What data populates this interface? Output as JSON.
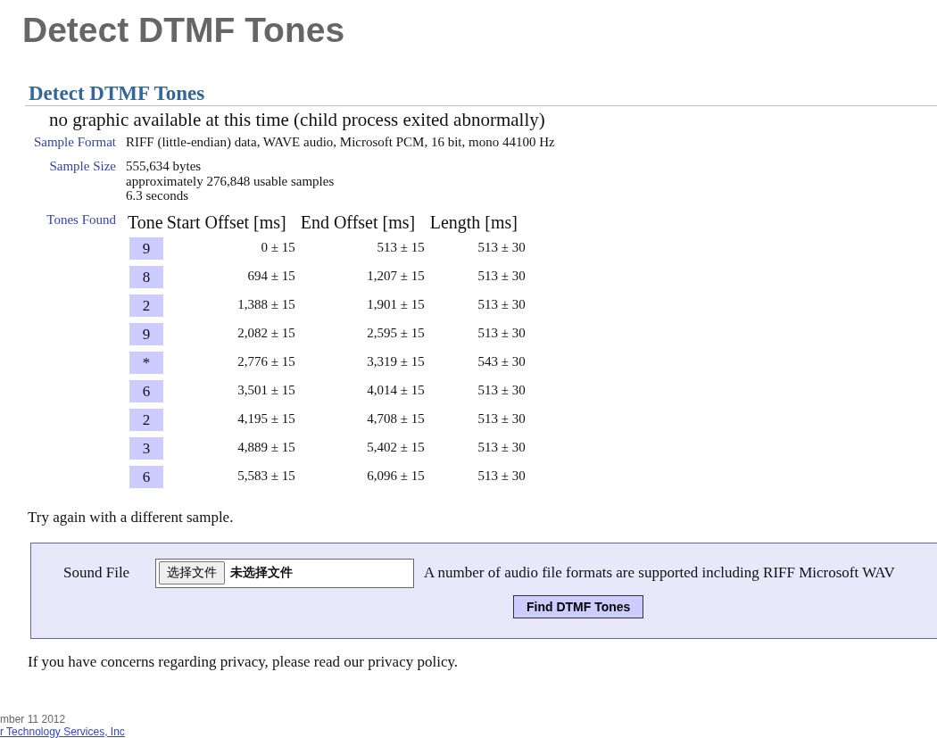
{
  "page_title": "Detect DTMF Tones",
  "section_title": "Detect DTMF Tones",
  "notice": "no graphic available at this time (child process exited abnormally)",
  "details": [
    {
      "label": "Sample Format",
      "lines": [
        "RIFF (little-endian) data, WAVE audio, Microsoft PCM, 16 bit, mono 44100 Hz"
      ]
    },
    {
      "label": "Sample Size",
      "lines": [
        "555,634 bytes",
        "approximately 276,848 usable samples",
        "6.3 seconds"
      ]
    }
  ],
  "tones": {
    "label": "Tones Found",
    "columns": [
      "Tone",
      "Start Offset [ms]",
      "End Offset [ms]",
      "Length [ms]"
    ],
    "rows": [
      [
        "9",
        "0 ± 15",
        "513 ± 15",
        "513 ± 30"
      ],
      [
        "8",
        "694 ± 15",
        "1,207 ± 15",
        "513 ± 30"
      ],
      [
        "2",
        "1,388 ± 15",
        "1,901 ± 15",
        "513 ± 30"
      ],
      [
        "9",
        "2,082 ± 15",
        "2,595 ± 15",
        "513 ± 30"
      ],
      [
        "*",
        "2,776 ± 15",
        "3,319 ± 15",
        "543 ± 30"
      ],
      [
        "6",
        "3,501 ± 15",
        "4,014 ± 15",
        "513 ± 30"
      ],
      [
        "2",
        "4,195 ± 15",
        "4,708 ± 15",
        "513 ± 30"
      ],
      [
        "3",
        "4,889 ± 15",
        "5,402 ± 15",
        "513 ± 30"
      ],
      [
        "6",
        "5,583 ± 15",
        "6,096 ± 15",
        "513 ± 30"
      ]
    ]
  },
  "retry": "Try again with a different sample.",
  "form": {
    "label": "Sound File",
    "choose_button": "选择文件",
    "file_status": "未选择文件",
    "hint": "A number of audio file formats are supported including RIFF Microsoft WAV",
    "submit": "Find DTMF Tones"
  },
  "privacy": "If you have concerns regarding privacy, please read our privacy policy.",
  "footer": {
    "date": "mber 11 2012",
    "company": "r Technology Services, Inc"
  }
}
